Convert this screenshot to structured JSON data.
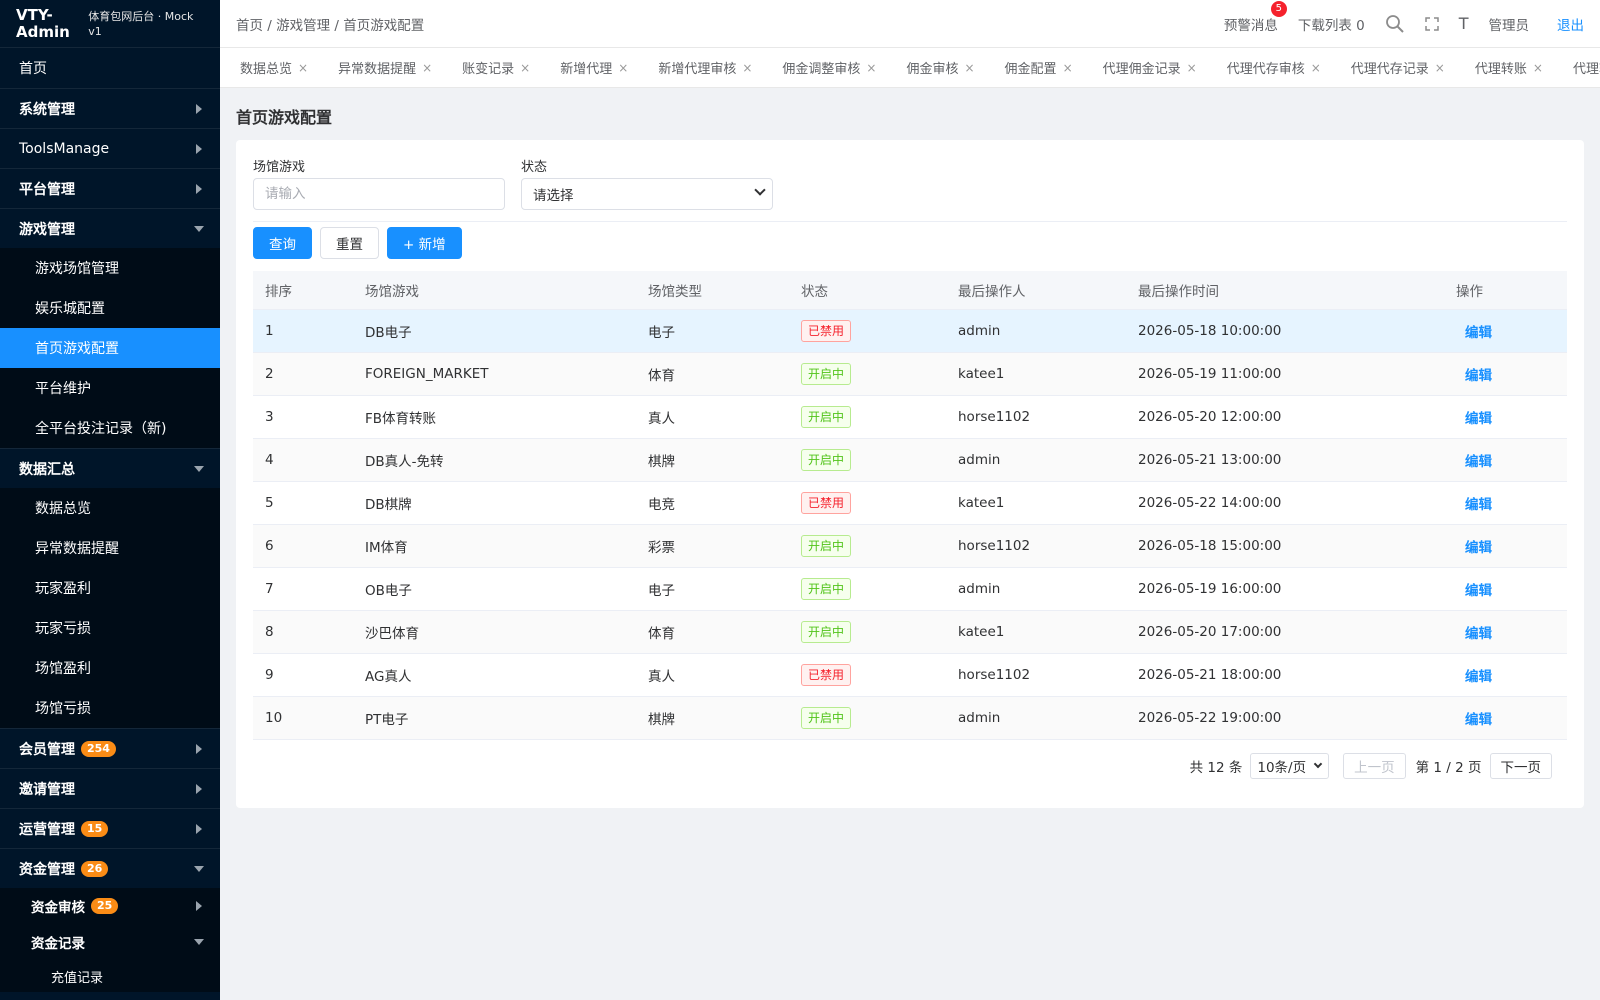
{
  "brand": {
    "logo": "VTY-Admin",
    "subtitle": "体育包网后台 · Mock v1"
  },
  "sidebar": {
    "items": [
      {
        "label": "首页"
      },
      {
        "label": "系统管理"
      },
      {
        "label": "ToolsManage"
      },
      {
        "label": "平台管理"
      },
      {
        "label": "游戏管理"
      },
      {
        "label": "游戏场馆管理"
      },
      {
        "label": "娱乐城配置"
      },
      {
        "label": "首页游戏配置"
      },
      {
        "label": "平台维护"
      },
      {
        "label": "全平台投注记录（新)"
      },
      {
        "label": "数据汇总"
      },
      {
        "label": "数据总览"
      },
      {
        "label": "异常数据提醒"
      },
      {
        "label": "玩家盈利"
      },
      {
        "label": "玩家亏损"
      },
      {
        "label": "场馆盈利"
      },
      {
        "label": "场馆亏损"
      },
      {
        "label": "会员管理",
        "badge": "254"
      },
      {
        "label": "邀请管理"
      },
      {
        "label": "运营管理",
        "badge": "15"
      },
      {
        "label": "资金管理",
        "badge": "26"
      },
      {
        "label": "资金审核",
        "badge": "25"
      },
      {
        "label": "资金记录"
      },
      {
        "label": "充值记录"
      }
    ]
  },
  "header": {
    "breadcrumb": "首页 / 游戏管理 / 首页游戏配置",
    "warning": "预警消息",
    "warning_count": "5",
    "downloads": "下载列表 0",
    "font_toggle": "T",
    "user": "管理员",
    "logout": "退出"
  },
  "tabs": [
    "数据总览",
    "异常数据提醒",
    "账变记录",
    "新增代理",
    "新增代理审核",
    "佣金调整审核",
    "佣金审核",
    "佣金配置",
    "代理佣金记录",
    "代理代存审核",
    "代理代存记录",
    "代理转账",
    "代理转账审核"
  ],
  "tab_close": "×",
  "page": {
    "title": "首页游戏配置"
  },
  "filters": {
    "game_label": "场馆游戏",
    "game_placeholder": "请输入",
    "status_label": "状态",
    "status_value": "请选择"
  },
  "buttons": {
    "query": "查询",
    "reset": "重置",
    "add": "+ 新增"
  },
  "table": {
    "columns": [
      "排序",
      "场馆游戏",
      "场馆类型",
      "状态",
      "最后操作人",
      "最后操作时间",
      "操作"
    ],
    "action_label": "编辑",
    "status_colors": {
      "off": "#f5222d",
      "on": "#52c41a"
    },
    "rows": [
      {
        "sort": "1",
        "game": "DB电子",
        "type": "电子",
        "status": "已禁用",
        "status_kind": "off",
        "operator": "admin",
        "time": "2026-05-18 10:00:00"
      },
      {
        "sort": "2",
        "game": "FOREIGN_MARKET",
        "type": "体育",
        "status": "开启中",
        "status_kind": "on",
        "operator": "katee1",
        "time": "2026-05-19 11:00:00"
      },
      {
        "sort": "3",
        "game": "FB体育转账",
        "type": "真人",
        "status": "开启中",
        "status_kind": "on",
        "operator": "horse1102",
        "time": "2026-05-20 12:00:00"
      },
      {
        "sort": "4",
        "game": "DB真人-免转",
        "type": "棋牌",
        "status": "开启中",
        "status_kind": "on",
        "operator": "admin",
        "time": "2026-05-21 13:00:00"
      },
      {
        "sort": "5",
        "game": "DB棋牌",
        "type": "电竞",
        "status": "已禁用",
        "status_kind": "off",
        "operator": "katee1",
        "time": "2026-05-22 14:00:00"
      },
      {
        "sort": "6",
        "game": "IM体育",
        "type": "彩票",
        "status": "开启中",
        "status_kind": "on",
        "operator": "horse1102",
        "time": "2026-05-18 15:00:00"
      },
      {
        "sort": "7",
        "game": "OB电子",
        "type": "电子",
        "status": "开启中",
        "status_kind": "on",
        "operator": "admin",
        "time": "2026-05-19 16:00:00"
      },
      {
        "sort": "8",
        "game": "沙巴体育",
        "type": "体育",
        "status": "开启中",
        "status_kind": "on",
        "operator": "katee1",
        "time": "2026-05-20 17:00:00"
      },
      {
        "sort": "9",
        "game": "AG真人",
        "type": "真人",
        "status": "已禁用",
        "status_kind": "off",
        "operator": "horse1102",
        "time": "2026-05-21 18:00:00"
      },
      {
        "sort": "10",
        "game": "PT电子",
        "type": "棋牌",
        "status": "开启中",
        "status_kind": "on",
        "operator": "admin",
        "time": "2026-05-22 19:00:00"
      }
    ]
  },
  "pagination": {
    "total": "共 12 条",
    "page_size": "10条/页",
    "prev": "上一页",
    "page_info": "第 1 / 2 页",
    "next": "下一页"
  },
  "colors": {
    "accent": "#1890ff",
    "sidebar_bg": "#001529",
    "badge": "#fa8c16"
  }
}
